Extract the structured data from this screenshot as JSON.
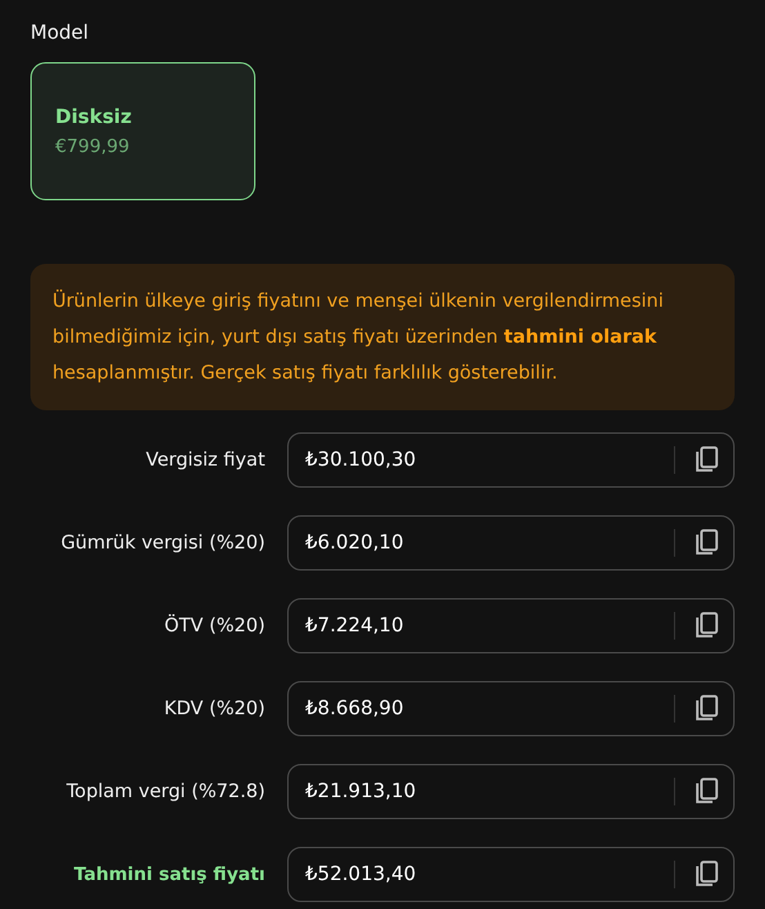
{
  "model_section": {
    "title": "Model",
    "options": [
      {
        "name": "Disksiz",
        "price": "€799,99",
        "selected": true
      }
    ]
  },
  "notice": "Ürünlerin ülkeye giriş fiyatını ve menşei ülkenin vergilendirmesini bilmediğimiz için, yurt dışı satış fiyatı üzerinden **tahmini olarak** hesaplanmıştır. Gerçek satış fiyatı farklılık gösterebilir.",
  "rows": [
    {
      "label": "Vergisiz fiyat",
      "value": "₺30.100,30",
      "kind": "normal"
    },
    {
      "label": "Gümrük vergisi (%20)",
      "value": "₺6.020,10",
      "kind": "normal"
    },
    {
      "label": "ÖTV (%20)",
      "value": "₺7.224,10",
      "kind": "normal"
    },
    {
      "label": "KDV (%20)",
      "value": "₺8.668,90",
      "kind": "normal"
    },
    {
      "label": "Toplam vergi (%72.8)",
      "value": "₺21.913,10",
      "kind": "normal"
    },
    {
      "label": "Tahmini satış fiyatı",
      "value": "₺52.013,40",
      "kind": "total"
    }
  ]
}
